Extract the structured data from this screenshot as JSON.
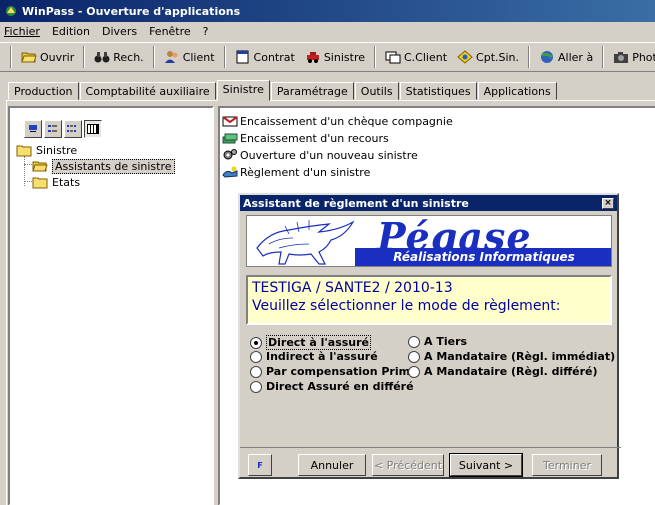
{
  "window": {
    "title": "WinPass - Ouverture d'applications"
  },
  "menu": [
    "Fichier",
    "Edition",
    "Divers",
    "Fenêtre",
    "?"
  ],
  "toolbar": {
    "buttons": [
      {
        "label": "Ouvrir",
        "icon": "open-folder-icon"
      },
      {
        "label": "Rech.",
        "icon": "binoculars-icon"
      },
      {
        "label": "Client",
        "icon": "client-icon"
      },
      {
        "label": "Contrat",
        "icon": "contract-icon"
      },
      {
        "label": "Sinistre",
        "icon": "sinistre-icon"
      },
      {
        "label": "C.Client",
        "icon": "account-icon"
      },
      {
        "label": "Cpt.Sin.",
        "icon": "claim-account-icon"
      },
      {
        "label": "Aller à",
        "icon": "goto-icon"
      },
      {
        "label": "Phot",
        "icon": "camera-icon"
      }
    ]
  },
  "tabs": [
    {
      "label": "Production",
      "active": false
    },
    {
      "label": "Comptabilité auxiliaire",
      "active": false
    },
    {
      "label": "Sinistre",
      "active": true
    },
    {
      "label": "Paramétrage",
      "active": false
    },
    {
      "label": "Outils",
      "active": false
    },
    {
      "label": "Statistiques",
      "active": false
    },
    {
      "label": "Applications",
      "active": false
    }
  ],
  "tree": {
    "root": "Sinistre",
    "children": [
      "Assistants de sinistre",
      "Etats"
    ],
    "selected": "Assistants de sinistre"
  },
  "actions": [
    {
      "label": "Encaissement d'un chèque compagnie",
      "icon": "check-envelope-icon"
    },
    {
      "label": "Encaissement d'un recours",
      "icon": "cash-stack-icon"
    },
    {
      "label": "Ouverture d'un nouveau sinistre",
      "icon": "gears-icon"
    },
    {
      "label": "Règlement d'un sinistre",
      "icon": "payment-icon"
    }
  ],
  "dialog": {
    "title": "Assistant de règlement d'un sinistre",
    "banner_brand": "Pégase",
    "banner_tagline": "Réalisations Informatiques",
    "message_line1": "TESTIGA  / SANTE2 / 2010-13",
    "message_line2": "Veuillez sélectionner le mode de règlement:",
    "options": [
      {
        "label": "Direct à l'assuré",
        "selected": true
      },
      {
        "label": "Indirect à l'assuré",
        "selected": false
      },
      {
        "label": "Par compensation Prime",
        "selected": false
      },
      {
        "label": "Direct Assuré en différé",
        "selected": false
      },
      {
        "label": "A Tiers",
        "selected": false
      },
      {
        "label": "A Mandataire (Règl. immédiat)",
        "selected": false
      },
      {
        "label": "A Mandataire (Règl. différé)",
        "selected": false
      }
    ],
    "flag_label": "F",
    "buttons": {
      "cancel": "Annuler",
      "previous": "< Précédent",
      "next": "Suivant >",
      "finish": "Terminer"
    }
  },
  "colors": {
    "title_bar": "#0a246a",
    "dialog_title": "#0a246a",
    "brand_blue": "#1a2fbf",
    "message_bg": "#ffffcc"
  }
}
